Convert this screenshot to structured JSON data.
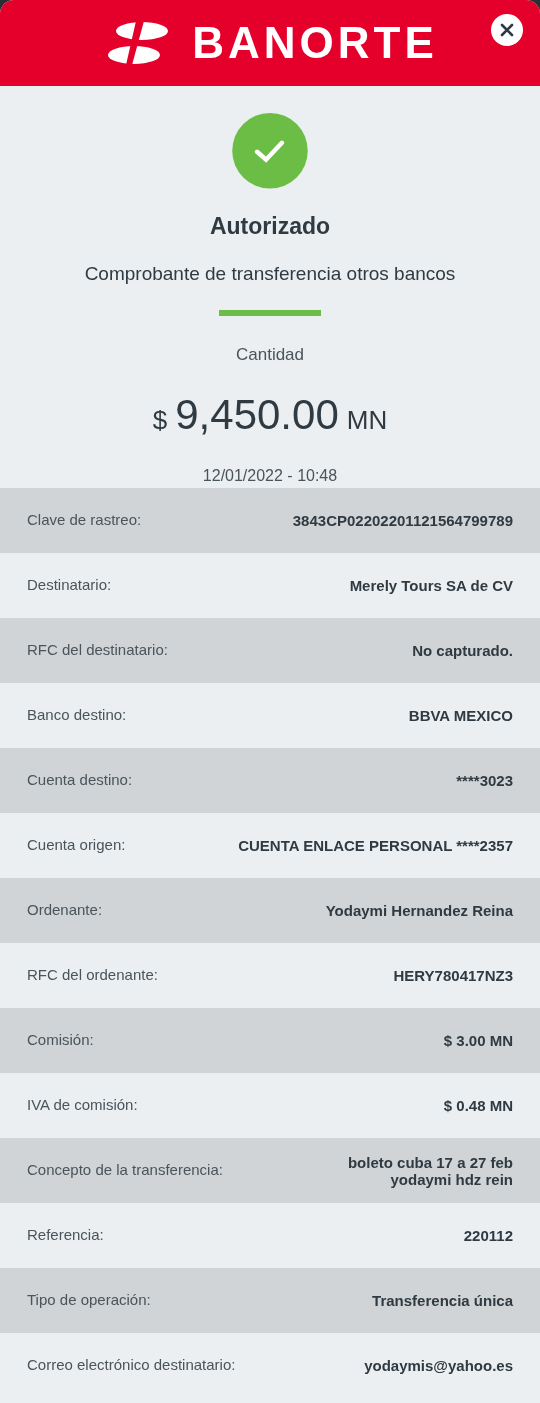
{
  "header": {
    "brand": "BANORTE"
  },
  "status": {
    "title": "Autorizado",
    "subtitle": "Comprobante de transferencia otros bancos"
  },
  "amount": {
    "label": "Cantidad",
    "currency_symbol": "$",
    "value": "9,450.00",
    "currency": "MN",
    "datetime": "12/01/2022 - 10:48"
  },
  "details": [
    {
      "label": "Clave de rastreo:",
      "value": "3843CP02202201121564799789"
    },
    {
      "label": "Destinatario:",
      "value": "Merely Tours SA de CV"
    },
    {
      "label": "RFC del destinatario:",
      "value": "No capturado."
    },
    {
      "label": "Banco destino:",
      "value": "BBVA MEXICO"
    },
    {
      "label": "Cuenta destino:",
      "value": "****3023"
    },
    {
      "label": "Cuenta origen:",
      "value": "CUENTA ENLACE PERSONAL ****2357"
    },
    {
      "label": "Ordenante:",
      "value": "Yodaymi Hernandez Reina"
    },
    {
      "label": "RFC del ordenante:",
      "value": "HERY780417NZ3"
    },
    {
      "label": "Comisión:",
      "value": "$ 3.00 MN"
    },
    {
      "label": "IVA de comisión:",
      "value": "$ 0.48 MN"
    },
    {
      "label": "Concepto de la transferencia:",
      "value": "boleto cuba 17 a 27 feb yodaymi hdz rein"
    },
    {
      "label": "Referencia:",
      "value": "220112"
    },
    {
      "label": "Tipo de operación:",
      "value": "Transferencia única"
    },
    {
      "label": "Correo electrónico destinatario:",
      "value": "yodaymis@yahoo.es"
    }
  ]
}
